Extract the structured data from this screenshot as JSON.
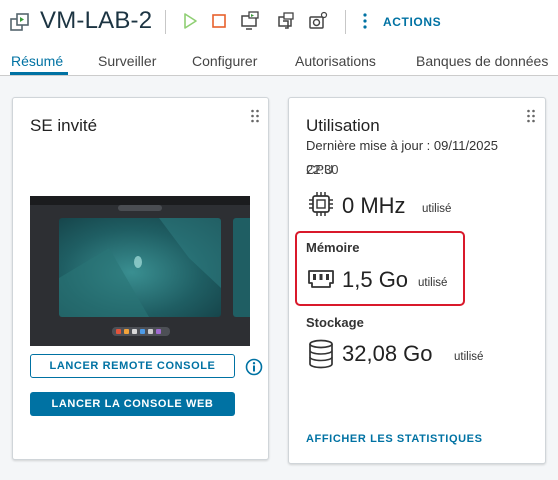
{
  "header": {
    "vm_name": "VM-LAB-2",
    "actions_label": "ACTIONS",
    "toolbar_icons": [
      "power-on-icon",
      "power-off-icon",
      "launch-console-icon",
      "migrate-icon",
      "snapshot-icon"
    ]
  },
  "tabs": [
    {
      "label": "Résumé",
      "active": true
    },
    {
      "label": "Surveiller",
      "active": false
    },
    {
      "label": "Configurer",
      "active": false
    },
    {
      "label": "Autorisations",
      "active": false
    },
    {
      "label": "Banques de données",
      "active": false
    }
  ],
  "guest_card": {
    "title": "SE invité",
    "remote_console_label": "LANCER REMOTE CONSOLE",
    "web_console_label": "LANCER LA CONSOLE WEB"
  },
  "usage_card": {
    "title": "Utilisation",
    "last_update": "Dernière mise à jour : 09/11/2025",
    "last_update_time": "22:30",
    "cpu": {
      "label": "CPU",
      "value": "0 MHz",
      "unit": "utilisé"
    },
    "memory": {
      "label": "Mémoire",
      "value": "1,5 Go",
      "unit": "utilisé"
    },
    "storage": {
      "label": "Stockage",
      "value": "32,08 Go",
      "unit": "utilisé"
    },
    "stats_link": "AFFICHER LES STATISTIQUES"
  },
  "colors": {
    "accent": "#0072a3",
    "highlight": "#d9192b",
    "power_on": "#8fcf73",
    "power_off": "#e8612c"
  }
}
